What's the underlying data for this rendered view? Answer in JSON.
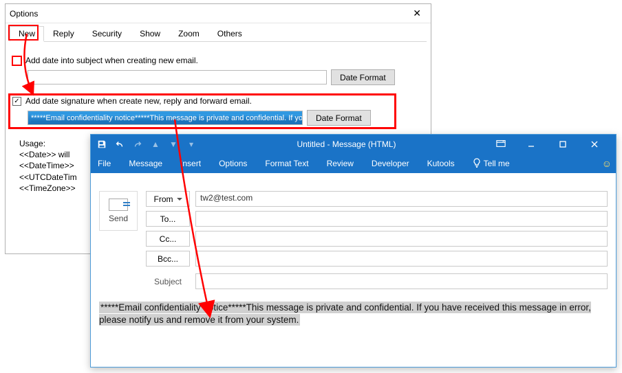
{
  "options": {
    "title": "Options",
    "tabs": [
      "New",
      "Reply",
      "Security",
      "Show",
      "Zoom",
      "Others"
    ],
    "add_date_subject_label": "Add date into subject when creating new email.",
    "add_date_subject_checked": false,
    "date_format_btn": "Date Format",
    "add_sig_label": "Add date signature when create new, reply and forward email.",
    "add_sig_checked": true,
    "sig_text": "*****Email confidentiality notice*****This message is private and confidential. If yo",
    "usage_title": "Usage:",
    "usage_lines": [
      "<<Date>> will",
      "<<DateTime>>",
      "<<UTCDateTim",
      "<<TimeZone>>"
    ]
  },
  "compose": {
    "window_title": "Untitled  -  Message (HTML)",
    "tabs": [
      "File",
      "Message",
      "Insert",
      "Options",
      "Format Text",
      "Review",
      "Developer",
      "Kutools"
    ],
    "tell_me": "Tell me",
    "send": "Send",
    "btn_from": "From",
    "btn_to": "To...",
    "btn_cc": "Cc...",
    "btn_bcc": "Bcc...",
    "subject_label": "Subject",
    "from_value": "tw2@test.com",
    "body": "*****Email confidentiality notice*****This message is private and confidential. If you have received this message in error, please notify us and remove it from your system."
  }
}
